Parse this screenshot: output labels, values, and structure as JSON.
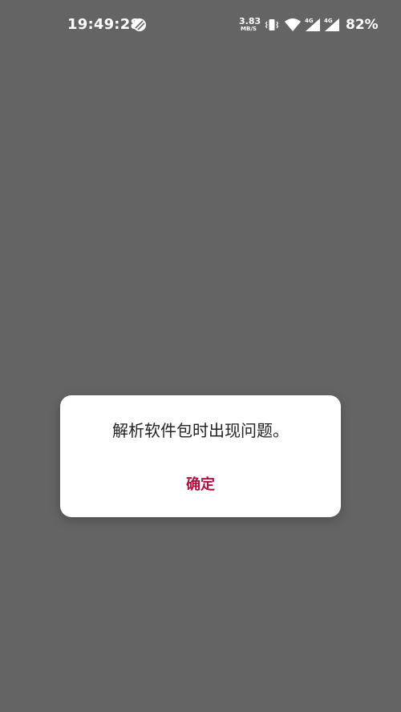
{
  "status_bar": {
    "time": "19:49:28",
    "net_speed_value": "3.83",
    "net_speed_unit": "MB/S",
    "sim1_network": "4G",
    "sim2_network": "4G",
    "battery": "82%",
    "icons": [
      "no-disturb-icon",
      "vibrate-icon",
      "wifi-icon",
      "signal-icon",
      "signal-icon"
    ]
  },
  "dialog": {
    "message": "解析软件包时出现问题。",
    "confirm_label": "确定"
  },
  "colors": {
    "background": "#646464",
    "accent": "#b0123f"
  }
}
